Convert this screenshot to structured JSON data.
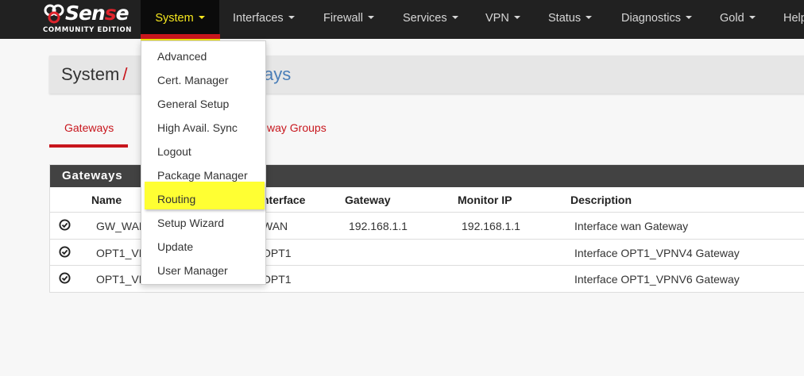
{
  "brand": {
    "word_pre": "Sen",
    "word_mid": "s",
    "word_post": "e",
    "subtitle": "COMMUNITY EDITION"
  },
  "nav": {
    "system": "System",
    "interfaces": "Interfaces",
    "firewall": "Firewall",
    "services": "Services",
    "vpn": "VPN",
    "status": "Status",
    "diagnostics": "Diagnostics",
    "gold": "Gold",
    "help": "Help"
  },
  "breadcrumb": {
    "root": "System",
    "separator": "/",
    "current_visible": "ays"
  },
  "tabs": {
    "gateways": "Gateways",
    "gateway_groups_visible": "way Groups"
  },
  "table": {
    "title": "Gateways",
    "headers": {
      "name": "Name",
      "interface_visible": "nterface",
      "gateway": "Gateway",
      "monitor_ip": "Monitor IP",
      "description": "Description"
    },
    "rows": [
      {
        "name": "GW_WAN",
        "interface": "WAN",
        "gateway": "192.168.1.1",
        "monitor_ip": "192.168.1.1",
        "description": "Interface wan Gateway"
      },
      {
        "name": "OPT1_VP",
        "interface": "OPT1",
        "gateway": "",
        "monitor_ip": "",
        "description": "Interface OPT1_VPNV4 Gateway"
      },
      {
        "name": "OPT1_VP",
        "interface": "OPT1",
        "gateway": "",
        "monitor_ip": "",
        "description": "Interface OPT1_VPNV6 Gateway"
      }
    ]
  },
  "system_menu": {
    "items": [
      "Advanced",
      "Cert. Manager",
      "General Setup",
      "High Avail. Sync",
      "Logout",
      "Package Manager",
      "Routing",
      "Setup Wizard",
      "Update",
      "User Manager"
    ],
    "highlighted": "Routing"
  },
  "colors": {
    "navbar": "#212121",
    "accent_red": "#c8161d",
    "highlight_yellow": "#ffff33",
    "active_text": "#f6e71e",
    "link_blue": "#4a7eb8"
  }
}
